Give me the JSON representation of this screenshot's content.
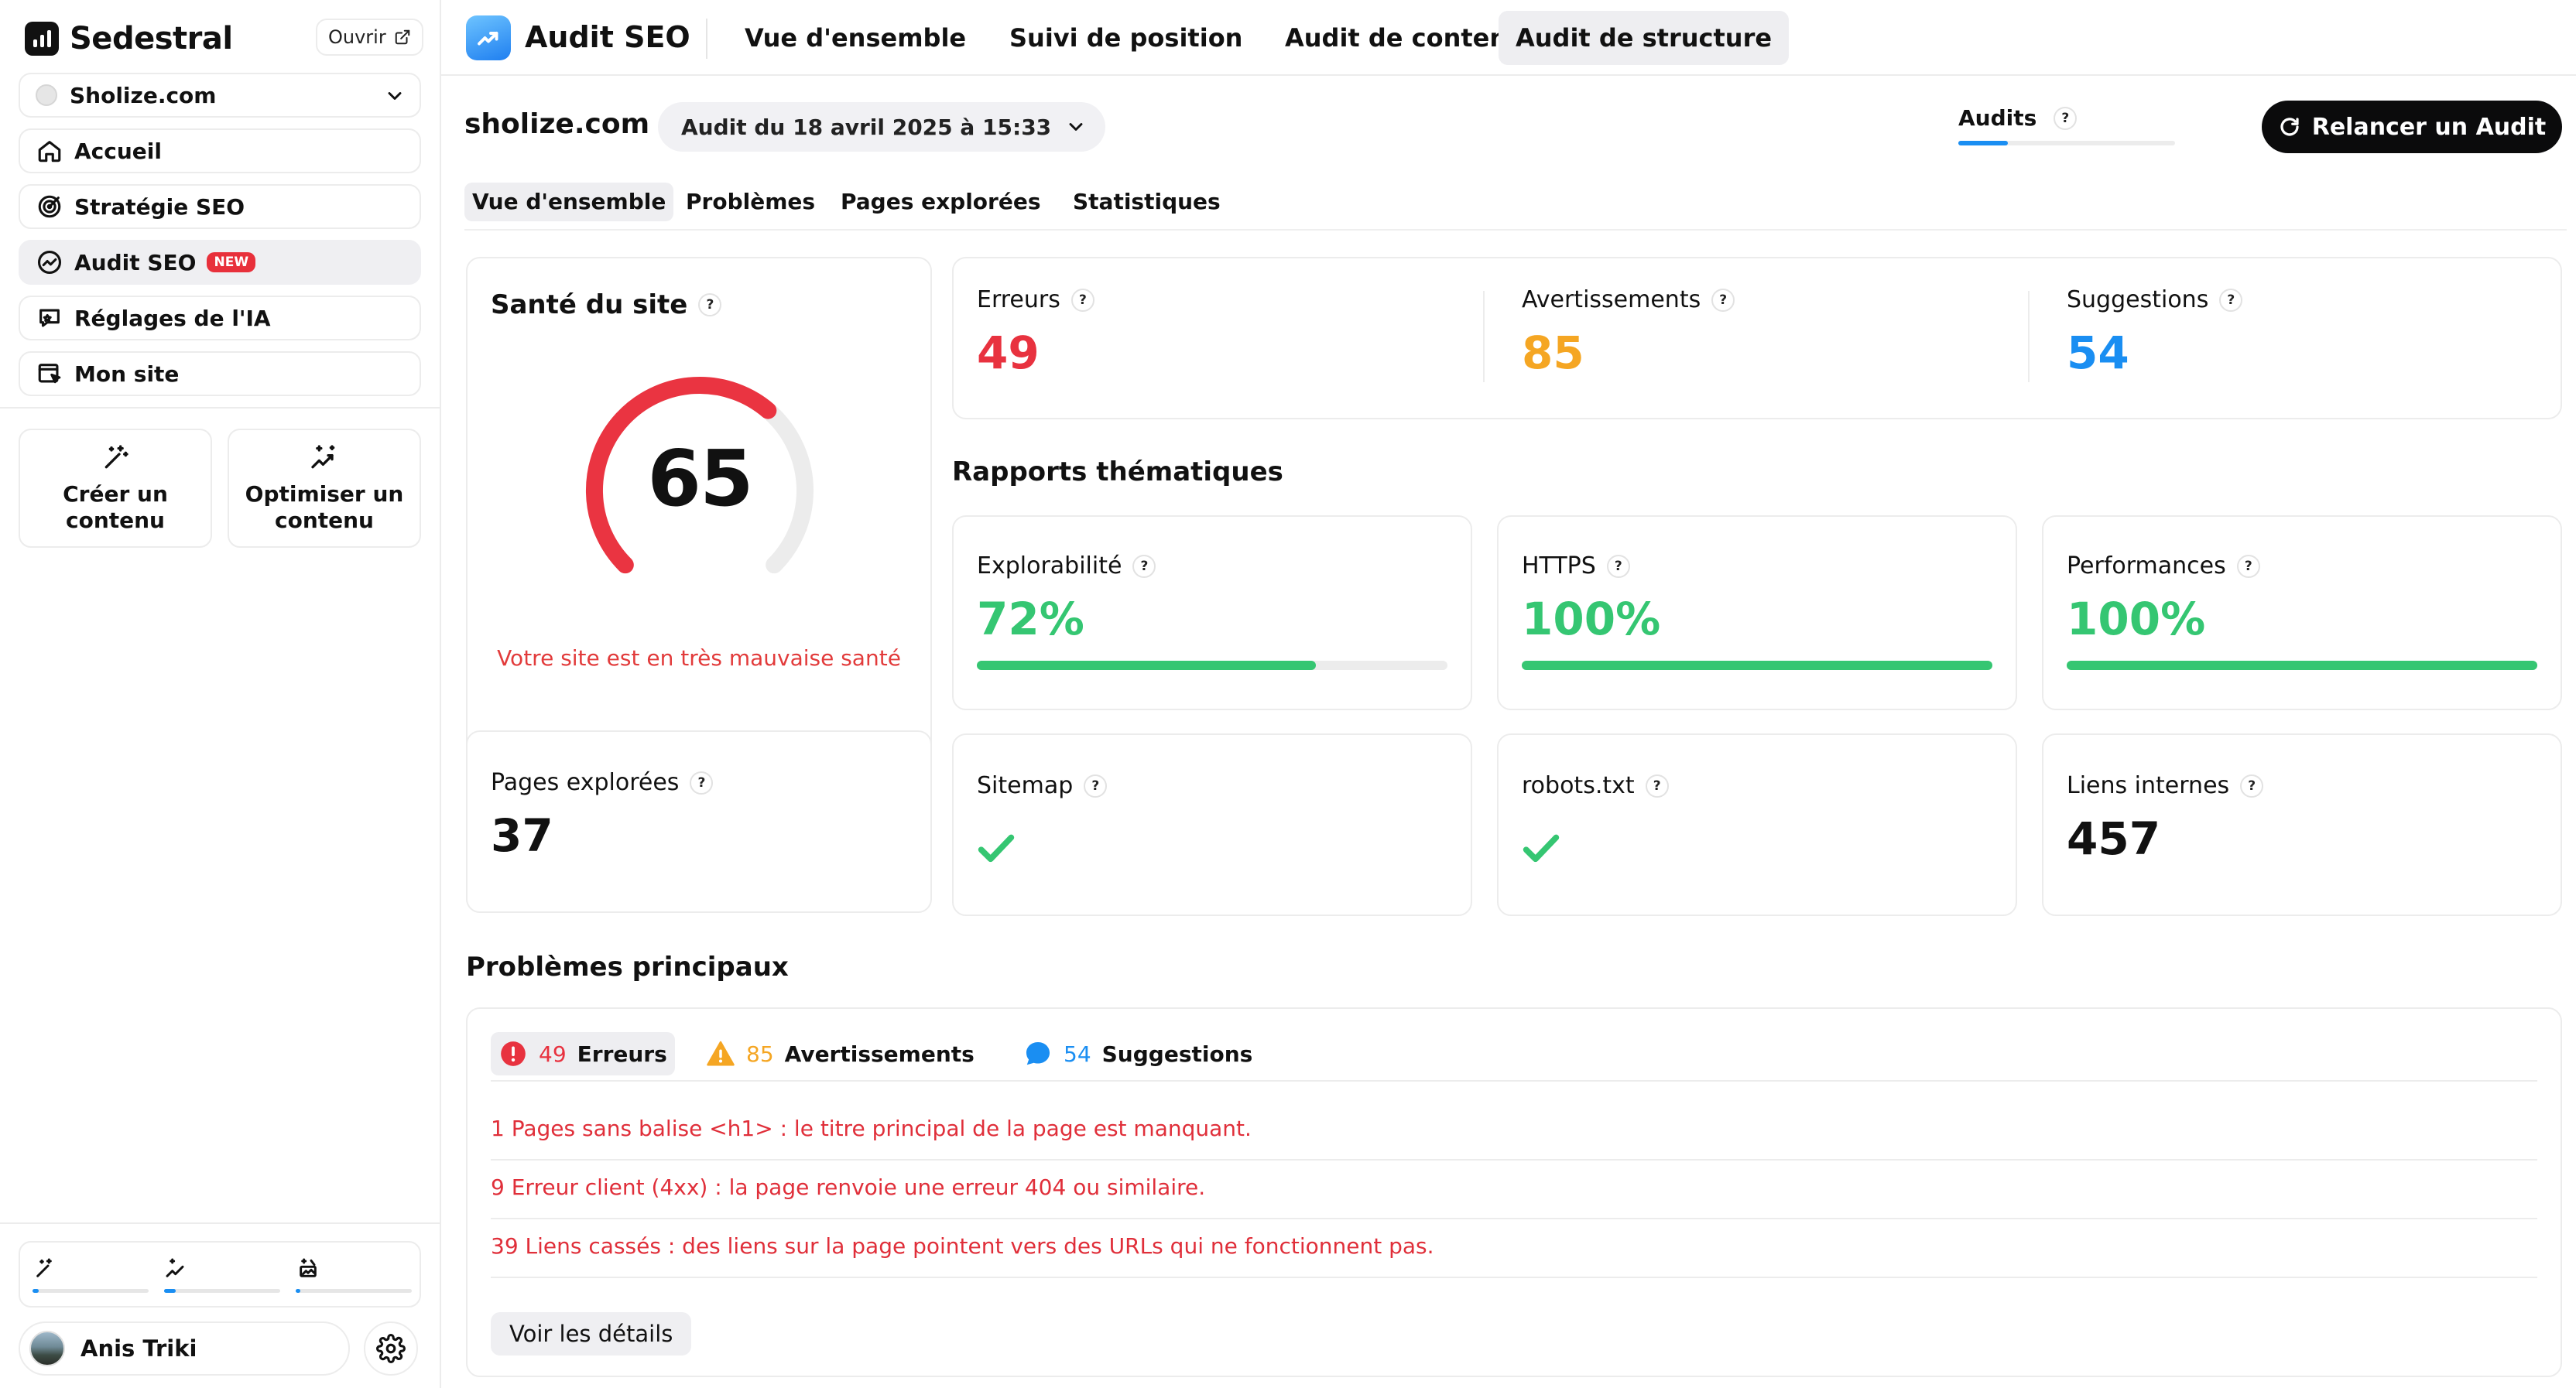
{
  "brand": {
    "name": "Sedestral",
    "open_label": "Ouvrir"
  },
  "sidebar": {
    "site": "Sholize.com",
    "items": [
      {
        "label": "Accueil",
        "icon": "home-icon"
      },
      {
        "label": "Stratégie SEO",
        "icon": "target-icon"
      },
      {
        "label": "Audit SEO",
        "icon": "trend-icon",
        "badge": "NEW"
      },
      {
        "label": "Réglages de l'IA",
        "icon": "ai-settings-icon"
      },
      {
        "label": "Mon site",
        "icon": "website-icon"
      }
    ],
    "actions": [
      {
        "label_line1": "Créer un",
        "label_line2": "contenu"
      },
      {
        "label_line1": "Optimiser un",
        "label_line2": "contenu"
      }
    ],
    "credits": [
      0.05,
      0.1,
      0.04
    ],
    "user": {
      "name": "Anis Triki"
    }
  },
  "topnav": {
    "app_title": "Audit SEO",
    "tabs": [
      "Vue d'ensemble",
      "Suivi de position",
      "Audit de contenu",
      "Audit de structure"
    ],
    "active_tab": "Audit de structure"
  },
  "header": {
    "domain": "sholize.com",
    "audit_select": "Audit du 18 avril 2025 à 15:33",
    "audits_label": "Audits",
    "audits_progress": 0.23,
    "relaunch_label": "Relancer un Audit"
  },
  "subtabs": [
    "Vue d'ensemble",
    "Problèmes",
    "Pages explorées",
    "Statistiques"
  ],
  "health": {
    "title": "Santé du site",
    "score": "65",
    "score_value": 65,
    "message": "Votre site est en très mauvaise santé",
    "color": "#ea3441"
  },
  "counts": {
    "errors": {
      "label": "Erreurs",
      "value": "49",
      "color": "#e8323f"
    },
    "warnings": {
      "label": "Avertissements",
      "value": "85",
      "color": "#f5a623"
    },
    "suggestions": {
      "label": "Suggestions",
      "value": "54",
      "color": "#1a8ef2"
    }
  },
  "reports": {
    "title": "Rapports thématiques",
    "items": [
      {
        "label": "Explorabilité",
        "value": "72%",
        "progress": 0.72
      },
      {
        "label": "HTTPS",
        "value": "100%",
        "progress": 1.0
      },
      {
        "label": "Performances",
        "value": "100%",
        "progress": 1.0
      }
    ]
  },
  "stats": {
    "pages": {
      "label": "Pages explorées",
      "value": "37"
    },
    "sitemap": {
      "label": "Sitemap"
    },
    "robots": {
      "label": "robots.txt"
    },
    "links": {
      "label": "Liens internes",
      "value": "457"
    }
  },
  "problems": {
    "title": "Problèmes principaux",
    "tabs": [
      {
        "count": "49",
        "label": "Erreurs"
      },
      {
        "count": "85",
        "label": "Avertissements"
      },
      {
        "count": "54",
        "label": "Suggestions"
      }
    ],
    "rows": [
      {
        "count": "1",
        "text": "Pages sans balise <h1> : le titre principal de la page est manquant."
      },
      {
        "count": "9",
        "text": "Erreur client (4xx) : la page renvoie une erreur 404 ou similaire."
      },
      {
        "count": "39",
        "text": "Liens cassés : des liens sur la page pointent vers des URLs qui ne fonctionnent pas."
      }
    ],
    "details_label": "Voir les détails"
  },
  "colors": {
    "green": "#35c672",
    "accent": "#1a8ef2",
    "error": "#e02f3a",
    "warning": "#f5a623"
  }
}
